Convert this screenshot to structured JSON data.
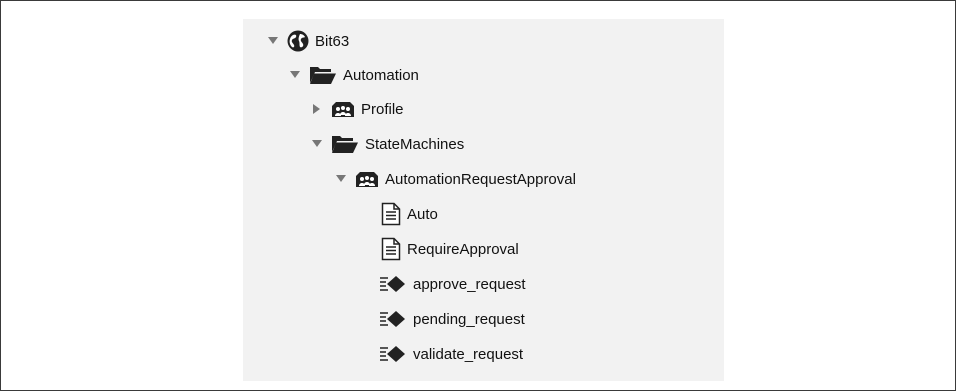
{
  "tree": {
    "root": {
      "label": "Bit63",
      "icon": "globe-icon",
      "expanded": true
    },
    "automation": {
      "label": "Automation",
      "icon": "folder-open-icon",
      "expanded": true
    },
    "profile": {
      "label": "Profile",
      "icon": "class-icon",
      "expanded": false
    },
    "state_machines": {
      "label": "StateMachines",
      "icon": "folder-open-icon",
      "expanded": true
    },
    "request_approval": {
      "label": "AutomationRequestApproval",
      "icon": "class-icon",
      "expanded": true
    },
    "instances": [
      {
        "label": "Auto",
        "icon": "document-icon"
      },
      {
        "label": "RequireApproval",
        "icon": "document-icon"
      }
    ],
    "methods": [
      {
        "label": "approve_request",
        "icon": "method-icon"
      },
      {
        "label": "pending_request",
        "icon": "method-icon"
      },
      {
        "label": "validate_request",
        "icon": "method-icon"
      }
    ]
  },
  "colors": {
    "panel_bg": "#f2f2f2",
    "icon_dark": "#222222",
    "toggle_gray": "#777777"
  }
}
